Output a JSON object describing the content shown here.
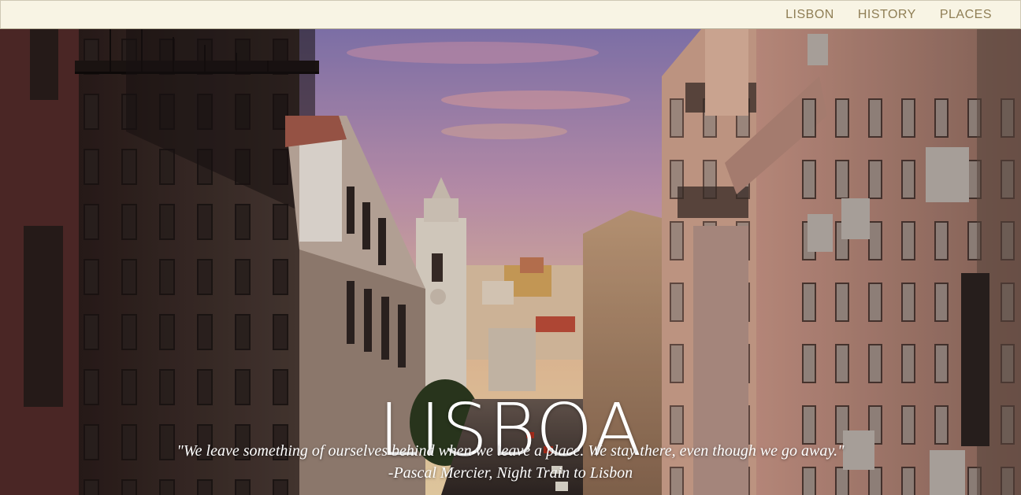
{
  "nav": {
    "links": [
      "LISBON",
      "HISTORY",
      "PLACES"
    ]
  },
  "hero": {
    "title": "LISBOA",
    "quote": "\"We leave something of ourselves behind when we leave a place. We stay there, even though we go away.\"",
    "attribution": "-Pascal Mercier, Night Train to Lisbon",
    "background_image": "street-view-photo"
  },
  "colors": {
    "nav_bg": "#f8f4e4",
    "nav_text": "#8f7e55",
    "title_text": "#ffffff"
  }
}
